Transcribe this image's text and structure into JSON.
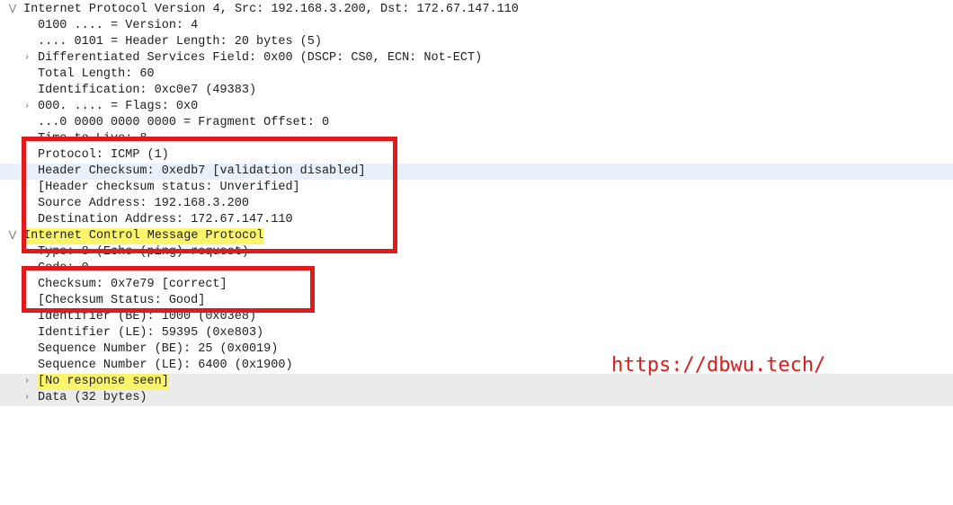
{
  "watermark": "https://dbwu.tech/",
  "rows": [
    {
      "indent": 0,
      "twisty": "down",
      "bg": "",
      "span_bg": "",
      "text_path": "ipv4.title"
    },
    {
      "indent": 1,
      "twisty": "",
      "bg": "",
      "span_bg": "",
      "text_path": "ipv4.version"
    },
    {
      "indent": 1,
      "twisty": "",
      "bg": "",
      "span_bg": "",
      "text_path": "ipv4.header_length"
    },
    {
      "indent": 1,
      "twisty": "right",
      "bg": "",
      "span_bg": "",
      "text_path": "ipv4.dscp"
    },
    {
      "indent": 1,
      "twisty": "",
      "bg": "",
      "span_bg": "",
      "text_path": "ipv4.total_length"
    },
    {
      "indent": 1,
      "twisty": "",
      "bg": "",
      "span_bg": "",
      "text_path": "ipv4.identification"
    },
    {
      "indent": 1,
      "twisty": "right",
      "bg": "",
      "span_bg": "",
      "text_path": "ipv4.flags"
    },
    {
      "indent": 1,
      "twisty": "",
      "bg": "",
      "span_bg": "",
      "text_path": "ipv4.frag_offset"
    },
    {
      "indent": 1,
      "twisty": "",
      "bg": "",
      "span_bg": "",
      "text_path": "ipv4.ttl"
    },
    {
      "indent": 1,
      "twisty": "",
      "bg": "",
      "span_bg": "",
      "text_path": "ipv4.protocol"
    },
    {
      "indent": 1,
      "twisty": "",
      "bg": "hl-blue",
      "span_bg": "",
      "text_path": "ipv4.checksum"
    },
    {
      "indent": 1,
      "twisty": "",
      "bg": "",
      "span_bg": "",
      "text_path": "ipv4.checksum_status"
    },
    {
      "indent": 1,
      "twisty": "",
      "bg": "",
      "span_bg": "",
      "text_path": "ipv4.src"
    },
    {
      "indent": 1,
      "twisty": "",
      "bg": "",
      "span_bg": "",
      "text_path": "ipv4.dst"
    },
    {
      "indent": 0,
      "twisty": "down",
      "bg": "",
      "span_bg": "hl-yellow-span",
      "text_path": "icmp.title"
    },
    {
      "indent": 1,
      "twisty": "",
      "bg": "",
      "span_bg": "",
      "text_path": "icmp.type"
    },
    {
      "indent": 1,
      "twisty": "",
      "bg": "",
      "span_bg": "",
      "text_path": "icmp.code"
    },
    {
      "indent": 1,
      "twisty": "",
      "bg": "",
      "span_bg": "",
      "text_path": "icmp.checksum"
    },
    {
      "indent": 1,
      "twisty": "",
      "bg": "",
      "span_bg": "",
      "text_path": "icmp.checksum_status"
    },
    {
      "indent": 1,
      "twisty": "",
      "bg": "",
      "span_bg": "",
      "text_path": "icmp.id_be"
    },
    {
      "indent": 1,
      "twisty": "",
      "bg": "",
      "span_bg": "",
      "text_path": "icmp.id_le"
    },
    {
      "indent": 1,
      "twisty": "",
      "bg": "",
      "span_bg": "",
      "text_path": "icmp.seq_be"
    },
    {
      "indent": 1,
      "twisty": "",
      "bg": "",
      "span_bg": "",
      "text_path": "icmp.seq_le"
    },
    {
      "indent": 1,
      "twisty": "right",
      "bg": "hl-gray",
      "span_bg": "hl-yellow-span",
      "text_path": "icmp.no_response"
    },
    {
      "indent": 1,
      "twisty": "right",
      "bg": "hl-gray",
      "span_bg": "",
      "text_path": "icmp.data"
    }
  ],
  "ipv4": {
    "title": "Internet Protocol Version 4, Src: 192.168.3.200, Dst: 172.67.147.110",
    "version": "0100 .... = Version: 4",
    "header_length": ".... 0101 = Header Length: 20 bytes (5)",
    "dscp": "Differentiated Services Field: 0x00 (DSCP: CS0, ECN: Not-ECT)",
    "total_length": "Total Length: 60",
    "identification": "Identification: 0xc0e7 (49383)",
    "flags": "000. .... = Flags: 0x0",
    "frag_offset": "...0 0000 0000 0000 = Fragment Offset: 0",
    "ttl": "Time to Live: 8",
    "protocol": "Protocol: ICMP (1)",
    "checksum": "Header Checksum: 0xedb7 [validation disabled]",
    "checksum_status": "[Header checksum status: Unverified]",
    "src": "Source Address: 192.168.3.200",
    "dst": "Destination Address: 172.67.147.110"
  },
  "icmp": {
    "title": "Internet Control Message Protocol",
    "type": "Type: 8 (Echo (ping) request)",
    "code": "Code: 0",
    "checksum": "Checksum: 0x7e79 [correct]",
    "checksum_status": "[Checksum Status: Good]",
    "id_be": "Identifier (BE): 1000 (0x03e8)",
    "id_le": "Identifier (LE): 59395 (0xe803)",
    "seq_be": "Sequence Number (BE): 25 (0x0019)",
    "seq_le": "Sequence Number (LE): 6400 (0x1900)",
    "no_response": "[No response seen]",
    "data": "Data (32 bytes)"
  }
}
